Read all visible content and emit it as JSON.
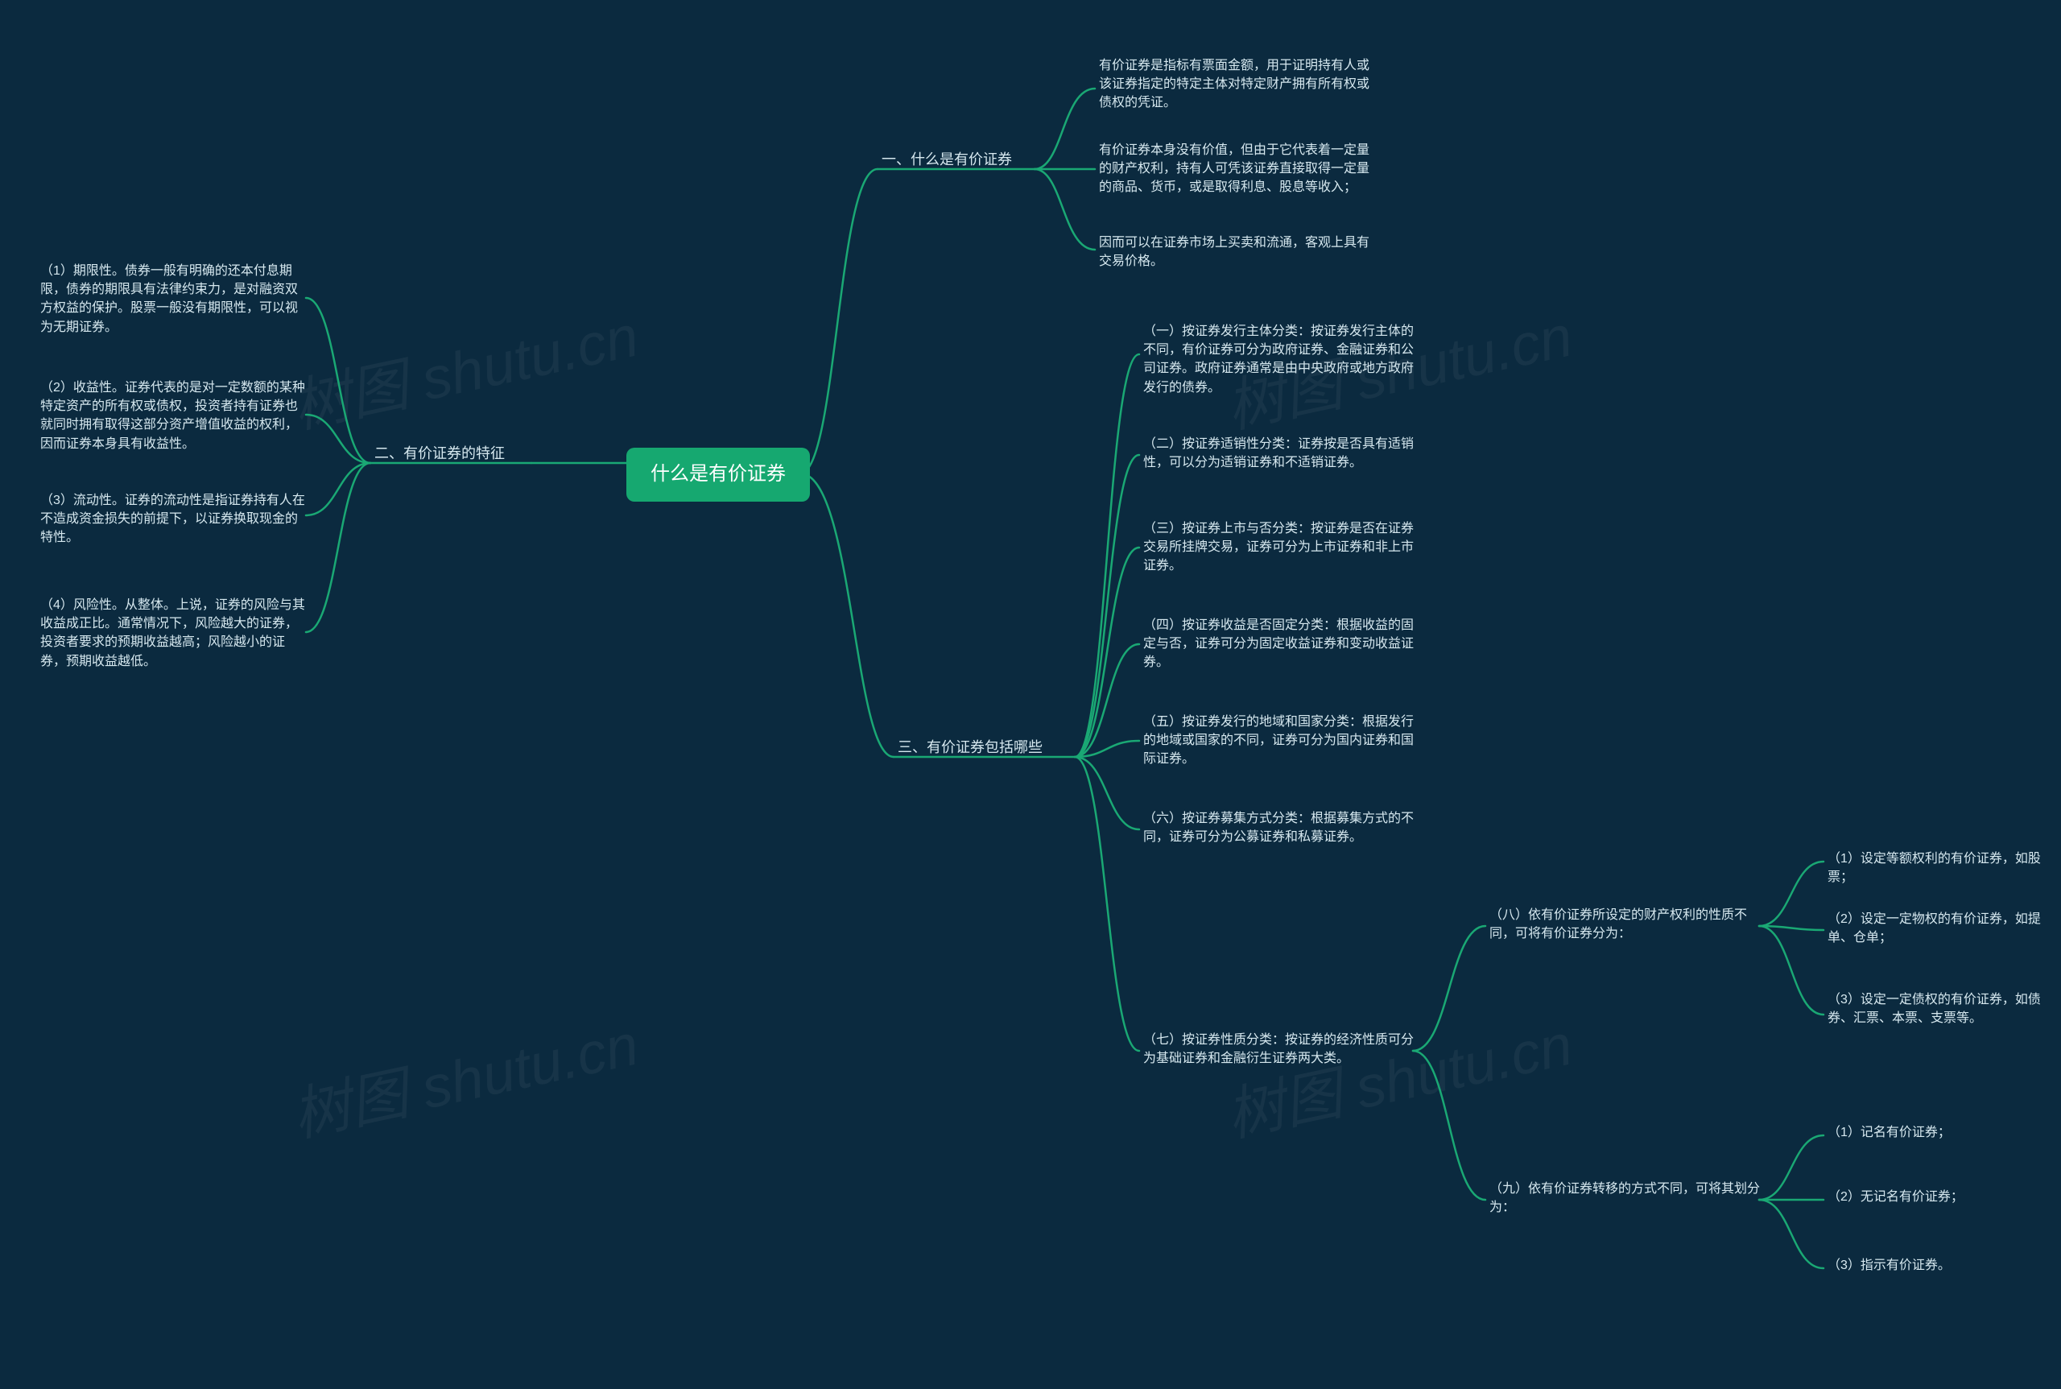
{
  "root": {
    "text": "什么是有价证券"
  },
  "watermark": "树图 shutu.cn",
  "rightBranches": {
    "b1": {
      "label": "一、什么是有价证券",
      "children": [
        {
          "key": "b1c1",
          "text": "有价证券是指标有票面金额，用于证明持有人或该证券指定的特定主体对特定财产拥有所有权或债权的凭证。"
        },
        {
          "key": "b1c2",
          "text": "有价证券本身没有价值，但由于它代表着一定量的财产权利，持有人可凭该证券直接取得一定量的商品、货币，或是取得利息、股息等收入；"
        },
        {
          "key": "b1c3",
          "text": "因而可以在证券市场上买卖和流通，客观上具有交易价格。"
        }
      ]
    },
    "b3": {
      "label": "三、有价证券包括哪些",
      "children": [
        {
          "key": "b3c1",
          "text": "（一）按证券发行主体分类：按证券发行主体的不同，有价证券可分为政府证券、金融证券和公司证券。政府证券通常是由中央政府或地方政府发行的债券。"
        },
        {
          "key": "b3c2",
          "text": "（二）按证券适销性分类：证券按是否具有适销性，可以分为适销证券和不适销证券。"
        },
        {
          "key": "b3c3",
          "text": "（三）按证券上市与否分类：按证券是否在证券交易所挂牌交易，证券可分为上市证券和非上市证券。"
        },
        {
          "key": "b3c4",
          "text": "（四）按证券收益是否固定分类：根据收益的固定与否，证券可分为固定收益证券和变动收益证券。"
        },
        {
          "key": "b3c5",
          "text": "（五）按证券发行的地域和国家分类：根据发行的地域或国家的不同，证券可分为国内证券和国际证券。"
        },
        {
          "key": "b3c6",
          "text": "（六）按证券募集方式分类：根据募集方式的不同，证券可分为公募证券和私募证券。"
        },
        {
          "key": "b3c7",
          "text": "（七）按证券性质分类：按证券的经济性质可分为基础证券和金融衍生证券两大类。",
          "children": [
            {
              "key": "b3c7a",
              "text": "（八）依有价证券所设定的财产权利的性质不同，可将有价证券分为：",
              "children": [
                {
                  "key": "b3c7a1",
                  "text": "（1）设定等额权利的有价证券，如股票；"
                },
                {
                  "key": "b3c7a2",
                  "text": "（2）设定一定物权的有价证券，如提单、仓单；"
                },
                {
                  "key": "b3c7a3",
                  "text": "（3）设定一定债权的有价证券，如债券、汇票、本票、支票等。"
                }
              ]
            },
            {
              "key": "b3c7b",
              "text": "（九）依有价证券转移的方式不同，可将其划分为：",
              "children": [
                {
                  "key": "b3c7b1",
                  "text": "（1）记名有价证券；"
                },
                {
                  "key": "b3c7b2",
                  "text": "（2）无记名有价证券；"
                },
                {
                  "key": "b3c7b3",
                  "text": "（3）指示有价证券。"
                }
              ]
            }
          ]
        }
      ]
    }
  },
  "leftBranch": {
    "b2": {
      "label": "二、有价证券的特征",
      "children": [
        {
          "key": "b2c1",
          "text": "（1）期限性。债券一般有明确的还本付息期限，债券的期限具有法律约束力，是对融资双方权益的保护。股票一般没有期限性，可以视为无期证券。"
        },
        {
          "key": "b2c2",
          "text": "（2）收益性。证券代表的是对一定数额的某种特定资产的所有权或债权，投资者持有证券也就同时拥有取得这部分资产增值收益的权利，因而证券本身具有收益性。"
        },
        {
          "key": "b2c3",
          "text": "（3）流动性。证券的流动性是指证券持有人在不造成资金损失的前提下，以证券换取现金的特性。"
        },
        {
          "key": "b2c4",
          "text": "（4）风险性。从整体。上说，证券的风险与其收益成正比。通常情况下，风险越大的证券，投资者要求的预期收益越高；风险越小的证券，预期收益越低。"
        }
      ]
    }
  }
}
